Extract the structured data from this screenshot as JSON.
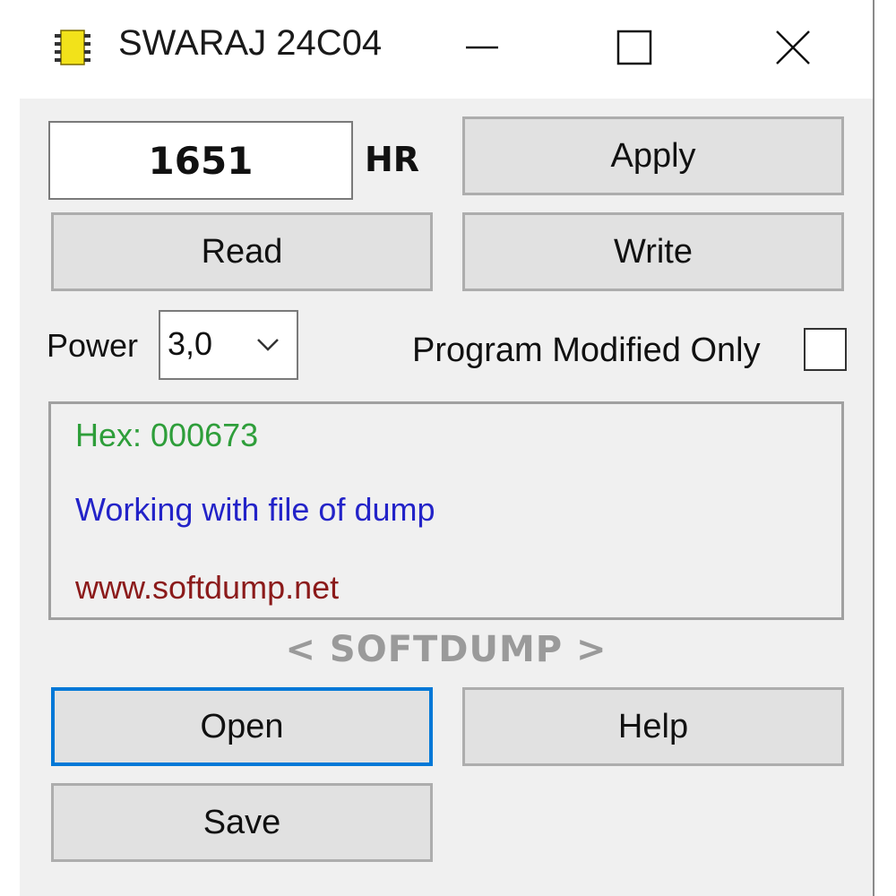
{
  "window": {
    "title": "SWARAJ 24C04",
    "icon": "chip-icon",
    "controls": {
      "minimize": "minimize-icon",
      "maximize": "maximize-icon",
      "close": "close-icon"
    }
  },
  "reading": {
    "value": "1651",
    "unit": "HR"
  },
  "buttons": {
    "apply": "Apply",
    "read": "Read",
    "write": "Write",
    "open": "Open",
    "help": "Help",
    "save": "Save"
  },
  "power": {
    "label": "Power",
    "selected": "3,0"
  },
  "program_modified_only": {
    "label": "Program Modified Only",
    "checked": false
  },
  "log": {
    "hex": "Hex: 000673",
    "status": "Working with file of dump",
    "url": "www.softdump.net"
  },
  "brand": "< SOFTDUMP >",
  "colors": {
    "hex_text": "#2e9e3a",
    "status_text": "#2323c8",
    "url_text": "#8b1a1a",
    "focus_border": "#0078d7",
    "chip_yellow": "#f2e21a"
  }
}
